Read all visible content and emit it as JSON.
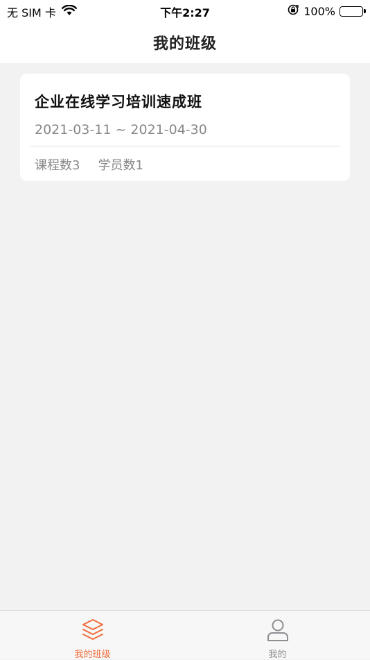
{
  "status_bar": {
    "carrier": "无 SIM 卡",
    "time": "下午2:27",
    "battery_percent": "100%",
    "battery_level": 1.0
  },
  "nav": {
    "title": "我的班级"
  },
  "class_card": {
    "title": "企业在线学习培训速成班",
    "date_range": "2021-03-11 ~ 2021-04-30",
    "courses": "课程数3",
    "students": "学员数1"
  },
  "tab_bar": {
    "tabs": [
      {
        "label": "我的班级",
        "icon": "layers-icon",
        "active": true
      },
      {
        "label": "我的",
        "icon": "user-icon",
        "active": false
      }
    ]
  },
  "colors": {
    "accent": "#f26b3a",
    "inactive": "#8e8e93",
    "background": "#f2f2f2"
  }
}
